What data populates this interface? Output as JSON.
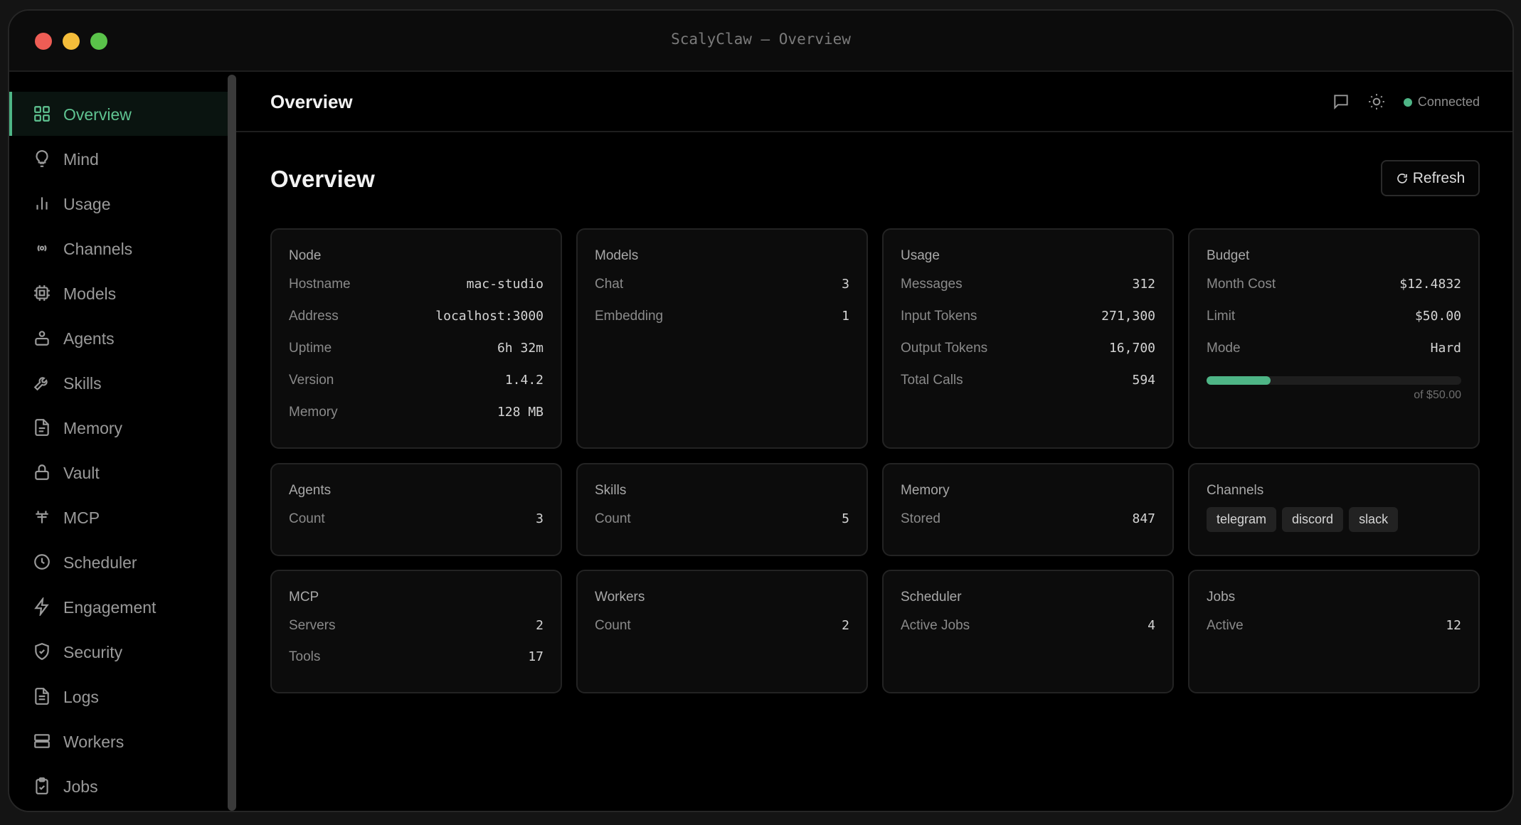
{
  "window": {
    "title": "ScalyClaw — Overview"
  },
  "sidebar": {
    "items": [
      {
        "label": "Overview",
        "icon": "grid-icon",
        "active": true
      },
      {
        "label": "Mind",
        "icon": "lightbulb-icon"
      },
      {
        "label": "Usage",
        "icon": "bar-chart-icon"
      },
      {
        "label": "Channels",
        "icon": "broadcast-icon"
      },
      {
        "label": "Models",
        "icon": "cpu-icon"
      },
      {
        "label": "Agents",
        "icon": "robot-icon"
      },
      {
        "label": "Skills",
        "icon": "wrench-icon"
      },
      {
        "label": "Memory",
        "icon": "document-icon"
      },
      {
        "label": "Vault",
        "icon": "lock-icon"
      },
      {
        "label": "MCP",
        "icon": "plug-icon"
      },
      {
        "label": "Scheduler",
        "icon": "clock-icon"
      },
      {
        "label": "Engagement",
        "icon": "lightning-icon"
      },
      {
        "label": "Security",
        "icon": "shield-icon"
      },
      {
        "label": "Logs",
        "icon": "file-text-icon"
      },
      {
        "label": "Workers",
        "icon": "server-icon"
      },
      {
        "label": "Jobs",
        "icon": "clipboard-check-icon"
      }
    ]
  },
  "header": {
    "title": "Overview",
    "status": "Connected",
    "icons": [
      "chat-icon",
      "sun-icon"
    ]
  },
  "page": {
    "title": "Overview",
    "refresh_label": "Refresh"
  },
  "cards": {
    "node": {
      "title": "Node",
      "rows": [
        {
          "k": "Hostname",
          "v": "mac-studio"
        },
        {
          "k": "Address",
          "v": "localhost:3000"
        },
        {
          "k": "Uptime",
          "v": "6h 32m"
        },
        {
          "k": "Version",
          "v": "1.4.2"
        },
        {
          "k": "Memory",
          "v": "128 MB"
        }
      ]
    },
    "models": {
      "title": "Models",
      "rows": [
        {
          "k": "Chat",
          "v": "3"
        },
        {
          "k": "Embedding",
          "v": "1"
        }
      ]
    },
    "usage": {
      "title": "Usage",
      "rows": [
        {
          "k": "Messages",
          "v": "312"
        },
        {
          "k": "Input Tokens",
          "v": "271,300"
        },
        {
          "k": "Output Tokens",
          "v": "16,700"
        },
        {
          "k": "Total Calls",
          "v": "594"
        }
      ]
    },
    "budget": {
      "title": "Budget",
      "rows": [
        {
          "k": "Month Cost",
          "v": "$12.4832"
        },
        {
          "k": "Limit",
          "v": "$50.00"
        },
        {
          "k": "Mode",
          "v": "Hard"
        }
      ],
      "progress_fraction": 0.25,
      "progress_caption": "of $50.00",
      "accent": "#4eb586"
    },
    "agents": {
      "title": "Agents",
      "rows": [
        {
          "k": "Count",
          "v": "3"
        }
      ]
    },
    "skills": {
      "title": "Skills",
      "rows": [
        {
          "k": "Count",
          "v": "5"
        }
      ]
    },
    "memory": {
      "title": "Memory",
      "rows": [
        {
          "k": "Stored",
          "v": "847"
        }
      ]
    },
    "channels": {
      "title": "Channels",
      "tags": [
        "telegram",
        "discord",
        "slack"
      ]
    },
    "mcp": {
      "title": "MCP",
      "rows": [
        {
          "k": "Servers",
          "v": "2"
        },
        {
          "k": "Tools",
          "v": "17"
        }
      ]
    },
    "workers": {
      "title": "Workers",
      "rows": [
        {
          "k": "Count",
          "v": "2"
        }
      ]
    },
    "scheduler": {
      "title": "Scheduler",
      "rows": [
        {
          "k": "Active Jobs",
          "v": "4"
        }
      ]
    },
    "jobs": {
      "title": "Jobs",
      "rows": [
        {
          "k": "Active",
          "v": "12"
        }
      ]
    }
  }
}
